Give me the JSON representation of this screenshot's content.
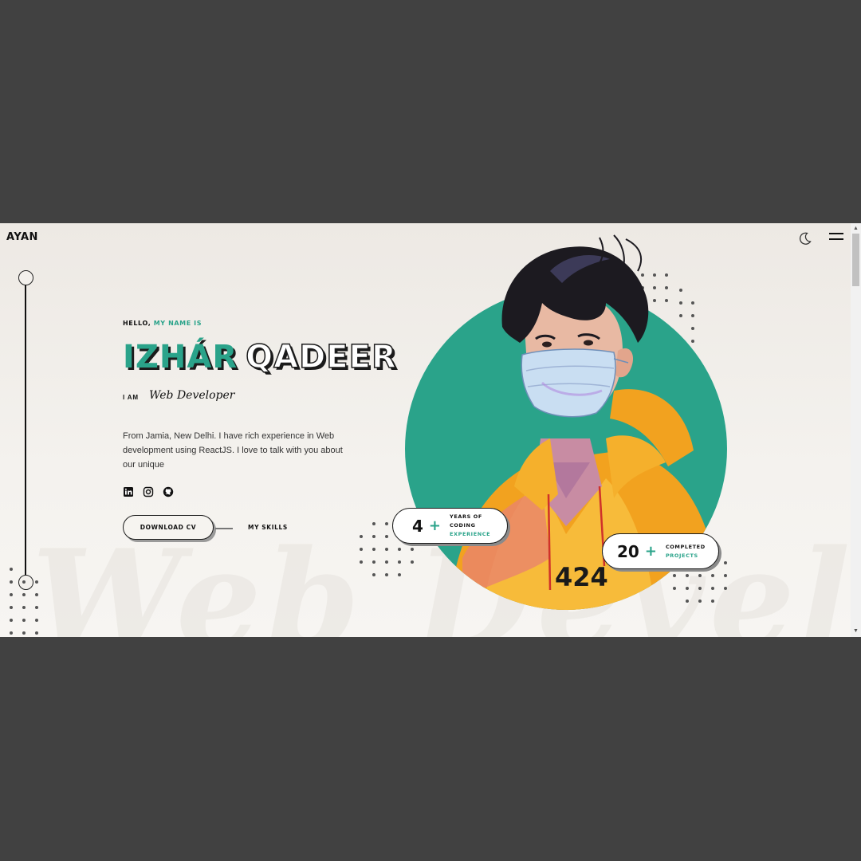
{
  "nav": {
    "logo": "AYAN",
    "theme_icon": "moon-icon",
    "menu_icon": "hamburger-menu-icon"
  },
  "hero": {
    "greeting_prefix": "HELLO,",
    "greeting_accent": "MY NAME IS",
    "first_name": "IZHÁR",
    "last_name": "QADEER",
    "iam_label": "I AM",
    "role": "Web Developer",
    "bio": "From Jamia, New Delhi. I have rich experience in Web development using ReactJS. I love to talk with you about our unique",
    "socials": [
      "linkedin-icon",
      "instagram-icon",
      "github-icon"
    ],
    "cv_button": "DOWNLOAD CV",
    "skills_link": "MY SKILLS",
    "background_text": "Web Developer",
    "shirt_text": "424"
  },
  "stats": [
    {
      "number": "4",
      "plus": "+",
      "line1": "YEARS OF",
      "line2": "CODING",
      "line3": "EXPERIENCE"
    },
    {
      "number": "20",
      "plus": "+",
      "line1": "COMPLETED",
      "line2": "PROJECTS"
    }
  ],
  "colors": {
    "accent": "#2aa38a",
    "hoodie": "#f2a21f",
    "background": "#f1eeea",
    "frame": "#414141"
  }
}
